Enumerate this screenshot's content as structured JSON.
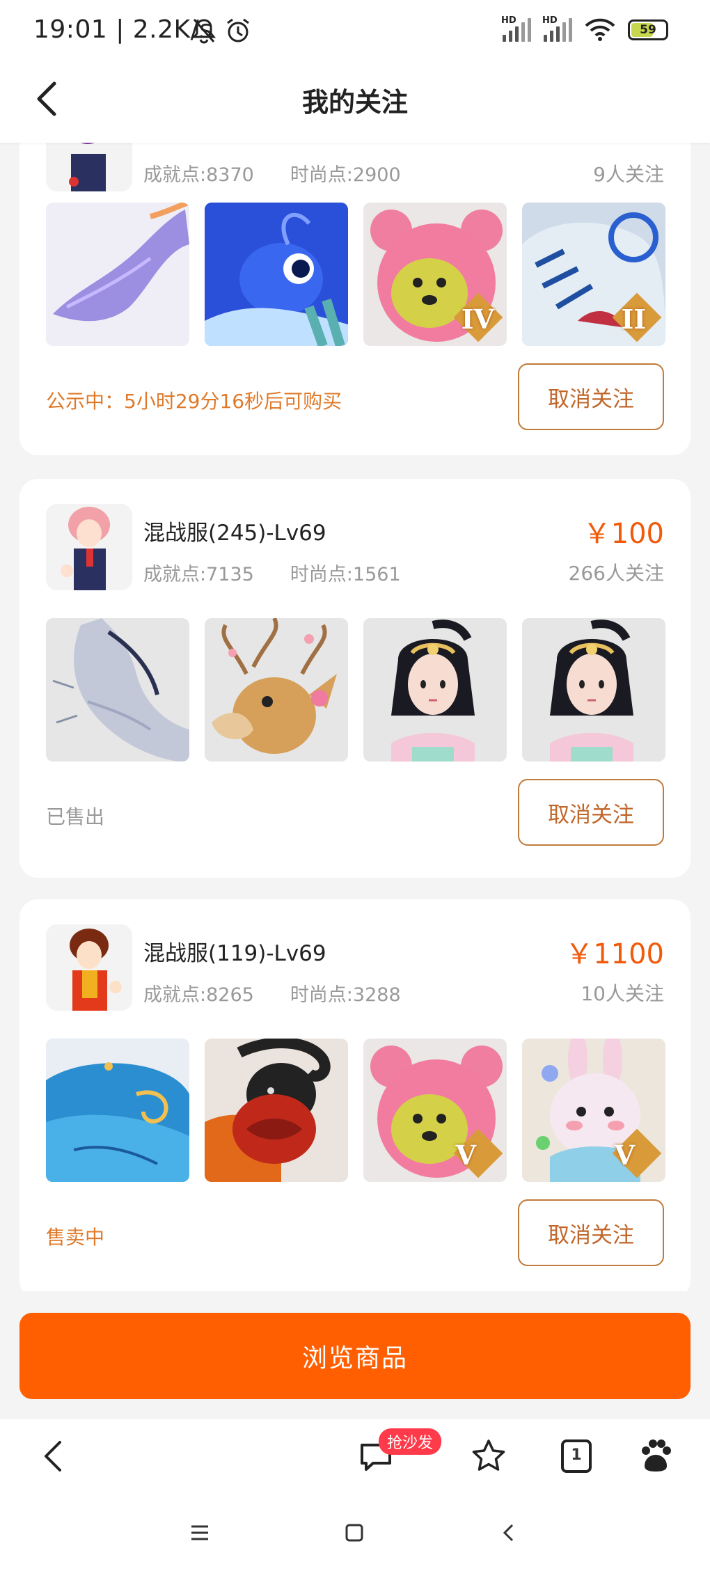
{
  "status_bar": {
    "time": "19:01 | 2.2K/s",
    "hd1": "HD",
    "hd2": "HD",
    "battery": "59"
  },
  "header": {
    "title": "我的关注"
  },
  "listings": [
    {
      "title": "",
      "achievement": "成就点:8370",
      "fashion": "时尚点:2900",
      "price": "",
      "followers": "9人关注",
      "status": "公示中：5小时29分16秒后可购买",
      "status_color": "#e07a2a",
      "button": "取消关注",
      "images": [
        "lavender-dragon",
        "blue-fish-creature",
        "pink-bear-hat-IV",
        "ice-tiger-II"
      ],
      "badges": [
        "",
        "",
        "IV",
        "II"
      ]
    },
    {
      "title": "混战服(245)-Lv69",
      "achievement": "成就点:7135",
      "fashion": "时尚点:1561",
      "price": "￥100",
      "followers": "266人关注",
      "status": "已售出",
      "status_color": "#999999",
      "button": "取消关注",
      "images": [
        "silver-dragon",
        "blossom-deer",
        "dancer-girl",
        "dancer-girl"
      ],
      "badges": [
        "",
        "",
        "",
        ""
      ]
    },
    {
      "title": "混战服(119)-Lv69",
      "achievement": "成就点:8265",
      "fashion": "时尚点:3288",
      "price": "￥1100",
      "followers": "10人关注",
      "status": "售卖中",
      "status_color": "#e07a2a",
      "button": "取消关注",
      "images": [
        "blue-whale",
        "black-ram",
        "pink-bear-hat-V",
        "bunny-V"
      ],
      "badges": [
        "",
        "",
        "V",
        "V"
      ]
    }
  ],
  "browse_button": "浏览商品",
  "browser_bar": {
    "comment_badge": "抢沙发",
    "tabs_count": "1"
  },
  "colors": {
    "accent": "#ff5f00",
    "price": "#f05a0a",
    "button_border": "#c07a3a"
  }
}
